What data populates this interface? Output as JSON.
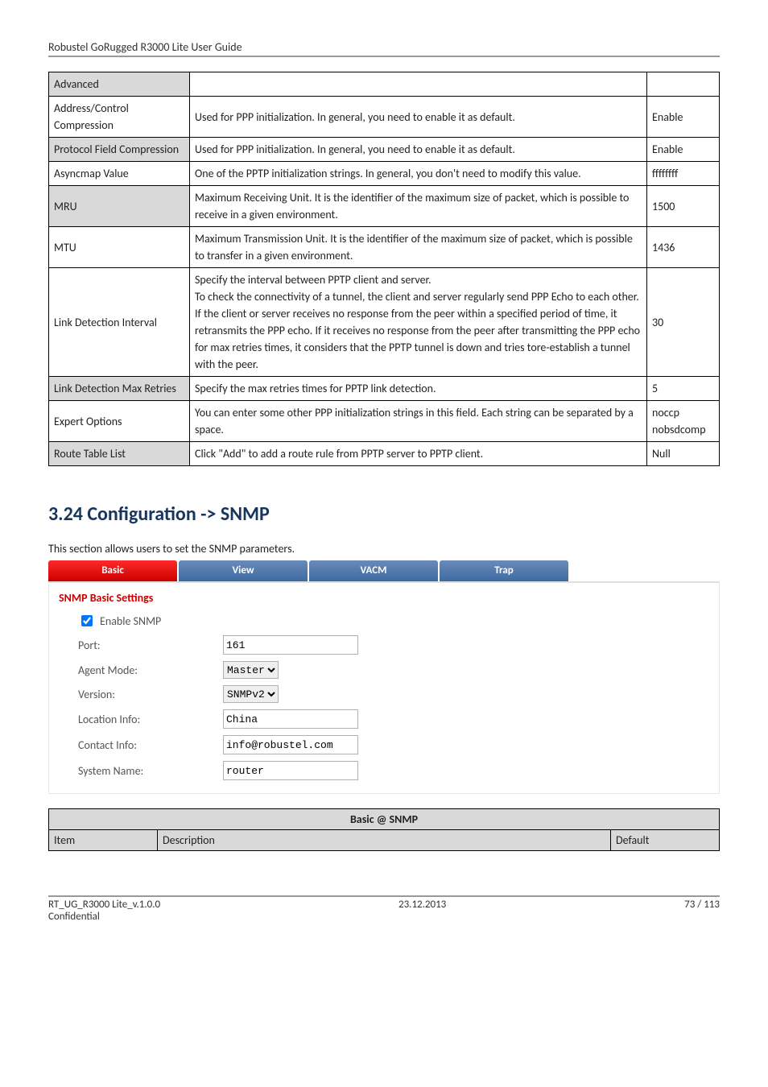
{
  "header": {
    "title": "Robustel GoRugged R3000 Lite User Guide"
  },
  "table": {
    "rows": [
      {
        "c1": "Advanced",
        "c2": "",
        "c3": "",
        "shade": true,
        "span": "first-only"
      },
      {
        "c1": "Address/Control Compression",
        "c2": "Used for PPP initialization. In general, you need to enable it as default.",
        "c3": "Enable"
      },
      {
        "c1": "Protocol Field Compression",
        "c2": "Used for PPP initialization. In general, you need to enable it as default.",
        "c3": "Enable",
        "shade": true,
        "c1split": true
      },
      {
        "c1": "Asyncmap Value",
        "c2": "One of the PPTP initialization strings. In general, you don't need to modify this value.",
        "c3": "ffffffff"
      },
      {
        "c1": "MRU",
        "c2": "Maximum Receiving Unit. It is the identifier of the maximum size of packet, which is possible to receive in a given environment.",
        "c3": "1500",
        "shade": true
      },
      {
        "c1": "MTU",
        "c2": "Maximum Transmission Unit. It is the identifier of the maximum size of packet, which is possible to transfer in a given environment.",
        "c3": "1436"
      },
      {
        "c1": "Link Detection Interval",
        "c2": "Specify the interval between PPTP client and server.\nTo check the connectivity of a tunnel, the client and server regularly send PPP Echo to each other. If the client or server receives no response from the peer within a specified period of time, it retransmits the PPP echo. If it receives no response from the peer after transmitting the PPP echo for max retries times, it considers that the PPTP tunnel is down and tries tore-establish a tunnel with the peer.",
        "c3": "30"
      },
      {
        "c1": "Link Detection Max Retries",
        "c2": "Specify the max retries times for PPTP link detection.",
        "c3": "5",
        "shade": true
      },
      {
        "c1": "Expert Options",
        "c2": "You can enter some other PPP initialization strings in this field. Each string can be separated by a space.",
        "c3": "noccp nobsdcomp"
      },
      {
        "c1": "Route Table List",
        "c2": "Click \"Add\" to add a route rule from PPTP server to PPTP client.",
        "c3": "Null",
        "shade": true
      }
    ]
  },
  "section": {
    "heading": "3.24  Configuration -> SNMP",
    "intro": "This section allows users to set the SNMP parameters."
  },
  "tabs": {
    "items": [
      "Basic",
      "View",
      "VACM",
      "Trap"
    ],
    "active": 0
  },
  "snmp": {
    "panel_title": "SNMP Basic Settings",
    "enable_label": "Enable SNMP",
    "enable_checked": true,
    "rows": {
      "port_label": "Port:",
      "port_value": "161",
      "agent_label": "Agent Mode:",
      "agent_value": "Master",
      "version_label": "Version:",
      "version_value": "SNMPv2",
      "location_label": "Location Info:",
      "location_value": "China",
      "contact_label": "Contact Info:",
      "contact_value": "info@robustel.com",
      "system_label": "System Name:",
      "system_value": "router"
    }
  },
  "small_table": {
    "caption": "Basic @ SNMP",
    "headers": {
      "item": "Item",
      "desc": "Description",
      "def": "Default"
    }
  },
  "footer": {
    "left1": "RT_UG_R3000 Lite_v.1.0.0",
    "left2": "Confidential",
    "center": "23.12.2013",
    "right": "73 / 113"
  }
}
